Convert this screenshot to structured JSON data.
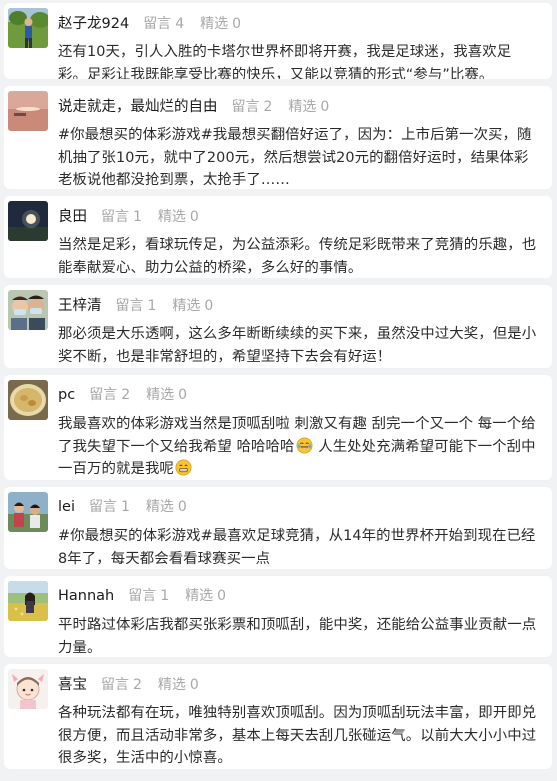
{
  "comments": [
    {
      "avatar_icon": "avatar-photo-person-field",
      "name": "赵子龙924",
      "leave_msg_label": "留言",
      "leave_msg_count": "4",
      "selected_label": "精选",
      "selected_count": "0",
      "text": "还有10天，引人入胜的卡塔尔世界杯即将开赛，我是足球迷，我喜欢足彩。足彩让我既能享受比赛的快乐，又能以竞猜的形式“参与”比赛。",
      "emoji": ""
    },
    {
      "avatar_icon": "avatar-photo-sunset-lake",
      "name": "说走就走，最灿烂的自由",
      "leave_msg_label": "留言",
      "leave_msg_count": "2",
      "selected_label": "精选",
      "selected_count": "0",
      "text": "#你最想买的体彩游戏#我最想买翻倍好运了，因为：上市后第一次买，随机抽了张10元，就中了200元，然后想尝试20元的翻倍好运时，结果体彩老板说他都没抢到票，太抢手了……",
      "emoji": ""
    },
    {
      "avatar_icon": "avatar-photo-night-moon",
      "name": "良田",
      "leave_msg_label": "留言",
      "leave_msg_count": "1",
      "selected_label": "精选",
      "selected_count": "0",
      "text": "当然是足彩，看球玩传足，为公益添彩。传统足彩既带来了竞猜的乐趣，也能奉献爱心、助力公益的桥梁，多么好的事情。",
      "emoji": ""
    },
    {
      "avatar_icon": "avatar-photo-two-people-masks",
      "name": "王梓清",
      "leave_msg_label": "留言",
      "leave_msg_count": "1",
      "selected_label": "精选",
      "selected_count": "0",
      "text": "那必须是大乐透啊，这么多年断断续续的买下来，虽然没中过大奖，但是小奖不断，也是非常舒坦的，希望坚持下去会有好运！",
      "emoji": ""
    },
    {
      "avatar_icon": "avatar-photo-food-plate",
      "name": "pc",
      "leave_msg_label": "留言",
      "leave_msg_count": "2",
      "selected_label": "精选",
      "selected_count": "0",
      "text": "我最喜欢的体彩游戏当然是顶呱刮啦 刺激又有趣 刮完一个又一个 每一个给了我失望下一个又给我希望 哈哈哈哈",
      "text_after": " 人生处处充满希望可能下一个刮中一百万的就是我呢",
      "emoji": "laughing-tears",
      "emoji2": "grinning"
    },
    {
      "avatar_icon": "avatar-photo-people-outdoor",
      "name": "lei",
      "leave_msg_label": "留言",
      "leave_msg_count": "1",
      "selected_label": "精选",
      "selected_count": "0",
      "text": "#你最想买的体彩游戏#最喜欢足球竞猜，从14年的世界杯开始到现在已经8年了，每天都会看看球赛买一点",
      "emoji": ""
    },
    {
      "avatar_icon": "avatar-photo-field-flowers",
      "name": "Hannah",
      "leave_msg_label": "留言",
      "leave_msg_count": "1",
      "selected_label": "精选",
      "selected_count": "0",
      "text": "平时路过体彩店我都买张彩票和顶呱刮，能中奖，还能给公益事业贡献一点力量。",
      "emoji": ""
    },
    {
      "avatar_icon": "avatar-drawing-girl-bow",
      "name": "喜宝",
      "leave_msg_label": "留言",
      "leave_msg_count": "2",
      "selected_label": "精选",
      "selected_count": "0",
      "text": "各种玩法都有在玩，唯独特别喜欢顶呱刮。因为顶呱刮玩法丰富，即开即兑很方便，而且活动非常多，基本上每天去刮几张碰运气。以前大大小小中过很多奖，生活中的小惊喜。",
      "emoji": ""
    }
  ]
}
